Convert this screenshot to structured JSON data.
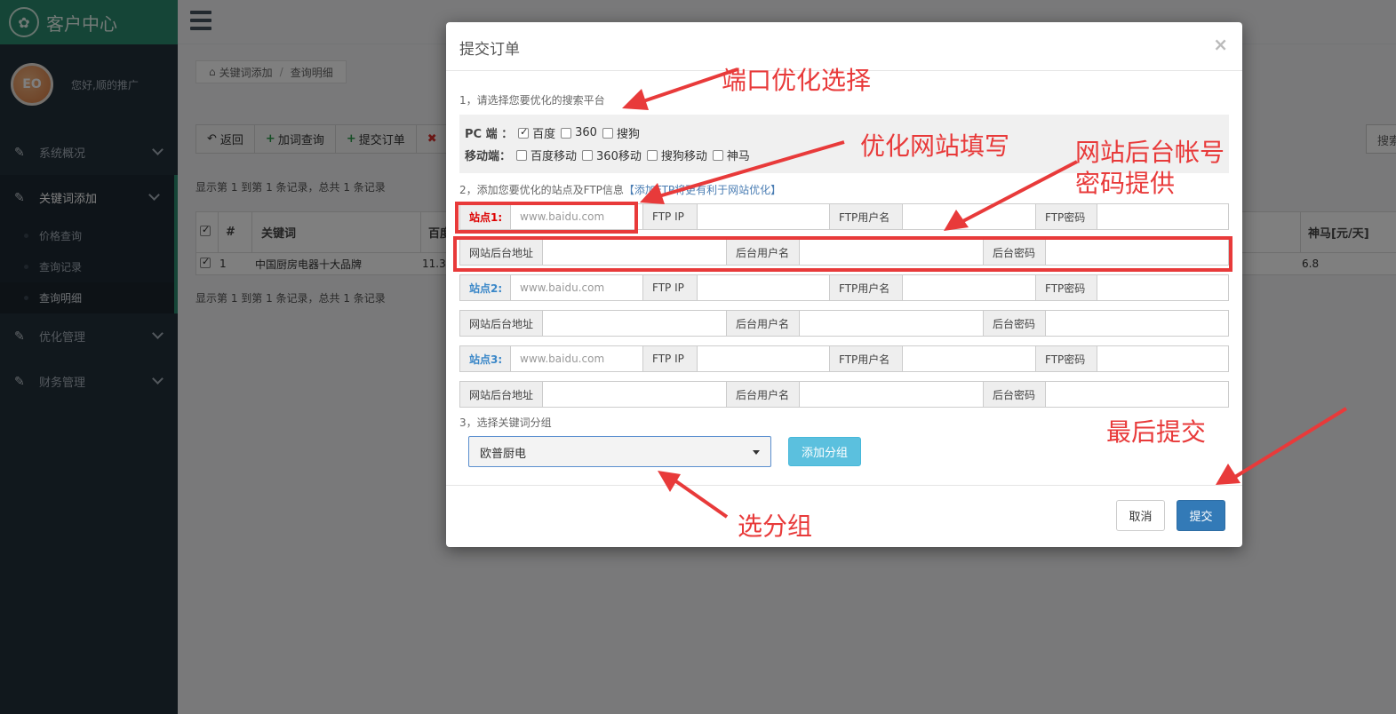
{
  "app": {
    "title": "客户中心"
  },
  "profile": {
    "greeting": "您好,顺的推广",
    "avatar_text": "EO"
  },
  "sidebar": {
    "items": [
      {
        "label": "系统概况"
      },
      {
        "label": "关键词添加"
      },
      {
        "label": "优化管理"
      },
      {
        "label": "财务管理"
      }
    ],
    "subitems": [
      {
        "label": "价格查询"
      },
      {
        "label": "查询记录"
      },
      {
        "label": "查询明细"
      }
    ]
  },
  "breadcrumb": {
    "home": "关键词添加",
    "current": "查询明细"
  },
  "toolbar": {
    "back": "返回",
    "add_query": "加词查询",
    "submit_order": "提交订单",
    "search_partial": "搜索"
  },
  "records_text": "显示第 1 到第 1 条记录，总共 1 条记录",
  "table": {
    "headers": {
      "num": "#",
      "keyword": "关键词",
      "baidu_partial": "百度",
      "shenma": "神马[元/天]"
    },
    "row": {
      "num": "1",
      "keyword": "中国厨房电器十大品牌",
      "baidu": "11.3",
      "shenma": "6.8"
    }
  },
  "modal": {
    "title": "提交订单",
    "close": "×",
    "step1": "1，请选择您要优化的搜索平台",
    "pc_label": "PC 端 ：",
    "pc_options": [
      {
        "label": "百度",
        "checked": true
      },
      {
        "label": "360",
        "checked": false
      },
      {
        "label": "搜狗",
        "checked": false
      }
    ],
    "mobile_label": "移动端：",
    "mobile_options": [
      {
        "label": "百度移动",
        "checked": false
      },
      {
        "label": "360移动",
        "checked": false
      },
      {
        "label": "搜狗移动",
        "checked": false
      },
      {
        "label": "神马",
        "checked": false
      }
    ],
    "step2": "2，添加您要优化的站点及FTP信息",
    "step2_note": "【添加FTP将更有利于网站优化】",
    "sites": [
      {
        "label": "站点1:",
        "placeholder": "www.baidu.com"
      },
      {
        "label": "站点2:",
        "placeholder": "www.baidu.com"
      },
      {
        "label": "站点3:",
        "placeholder": "www.baidu.com"
      }
    ],
    "ftp_ip": "FTP IP",
    "ftp_user": "FTP用户名",
    "ftp_pass": "FTP密码",
    "admin_url": "网站后台地址",
    "admin_user": "后台用户名",
    "admin_pass": "后台密码",
    "step3": "3，选择关键词分组",
    "group_selected": "欧普厨电",
    "add_group": "添加分组",
    "cancel": "取消",
    "submit": "提交"
  },
  "annotations": {
    "port": "端口优化选择",
    "site": "优化网站填写",
    "admin_line1": "网站后台帐号",
    "admin_line2": "密码提供",
    "final": "最后提交",
    "group": "选分组",
    "color": "#e83a3a"
  }
}
